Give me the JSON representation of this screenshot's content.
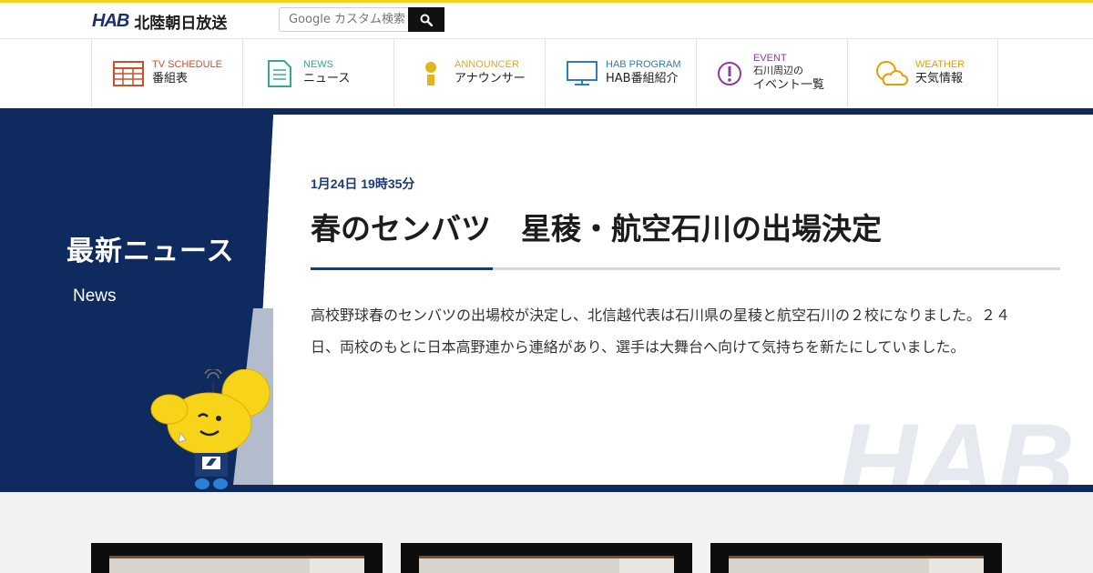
{
  "header": {
    "logo_mark": "HAB",
    "logo_name": "北陸朝日放送",
    "search_placeholder": "Google カスタム検索",
    "search_icon": "search-icon",
    "accent_color": "#f2d21c"
  },
  "nav": [
    {
      "en": "TV SCHEDULE",
      "ja": "番組表",
      "icon": "tv-schedule-icon",
      "color": "#c9512b"
    },
    {
      "en": "NEWS",
      "ja": "ニュース",
      "icon": "news-icon",
      "color": "#3aa88f"
    },
    {
      "en": "ANNOUNCER",
      "ja": "アナウンサー",
      "icon": "announcer-icon",
      "color": "#e2a91c"
    },
    {
      "en": "HAB PROGRAM",
      "ja": "HAB番組紹介",
      "icon": "monitor-icon",
      "color": "#2c7fb8"
    },
    {
      "en": "EVENT",
      "ja1": "石川周辺の",
      "ja": "イベント一覧",
      "icon": "event-icon",
      "color": "#8a3c9e"
    },
    {
      "en": "WEATHER",
      "ja": "天気情報",
      "icon": "weather-icon",
      "color": "#e0a000"
    }
  ],
  "section": {
    "title": "最新ニュース",
    "subtitle": "News"
  },
  "article": {
    "date": "1月24日 19時35分",
    "title": "春のセンバツ　星稜・航空石川の出場決定",
    "body": "高校野球春のセンバツの出場校が決定し、北信越代表は石川県の星稜と航空石川の２校になりました。２４日、両校のもとに日本高野連から連絡があり、選手は大舞台へ向けて気持ちを新たにしていました。"
  },
  "watermark": "HAB",
  "colors": {
    "navy": "#0e2a5e",
    "date": "#1c3a74"
  }
}
